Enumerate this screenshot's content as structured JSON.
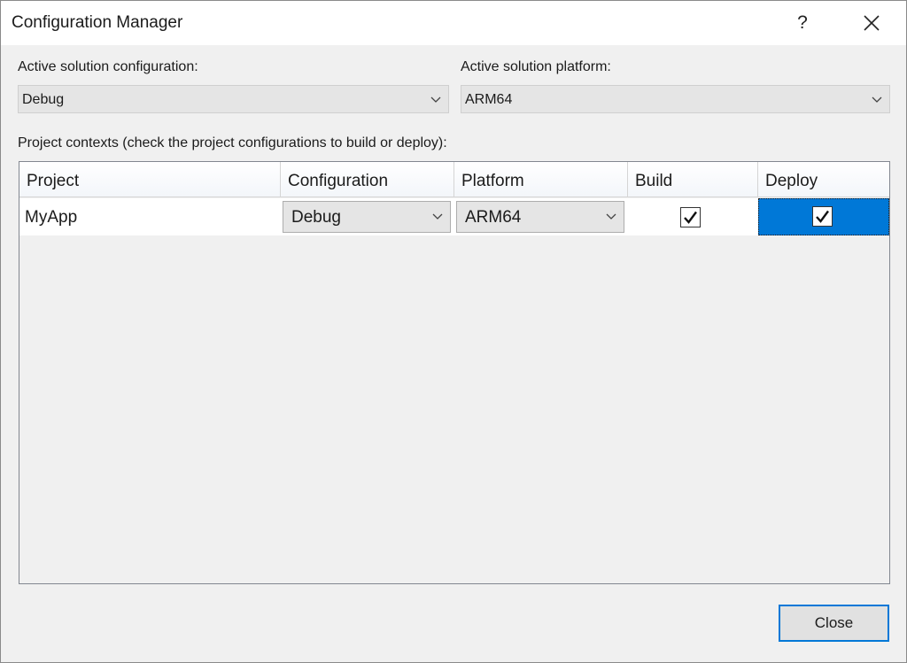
{
  "window": {
    "title": "Configuration Manager",
    "help_glyph": "?"
  },
  "active_config": {
    "label": "Active solution configuration:",
    "value": "Debug"
  },
  "active_platform": {
    "label": "Active solution platform:",
    "value": "ARM64"
  },
  "contexts_label": "Project contexts (check the project configurations to build or deploy):",
  "grid": {
    "columns": [
      "Project",
      "Configuration",
      "Platform",
      "Build",
      "Deploy"
    ],
    "rows": [
      {
        "project": "MyApp",
        "configuration": "Debug",
        "platform": "ARM64",
        "build": true,
        "deploy": true
      }
    ]
  },
  "footer": {
    "close_label": "Close"
  },
  "colors": {
    "accent": "#0078d7",
    "window_bg": "#f0f0f0"
  },
  "icons": {
    "close": "close-icon",
    "dropdown": "chevron-down-icon",
    "check": "checkmark-icon"
  }
}
